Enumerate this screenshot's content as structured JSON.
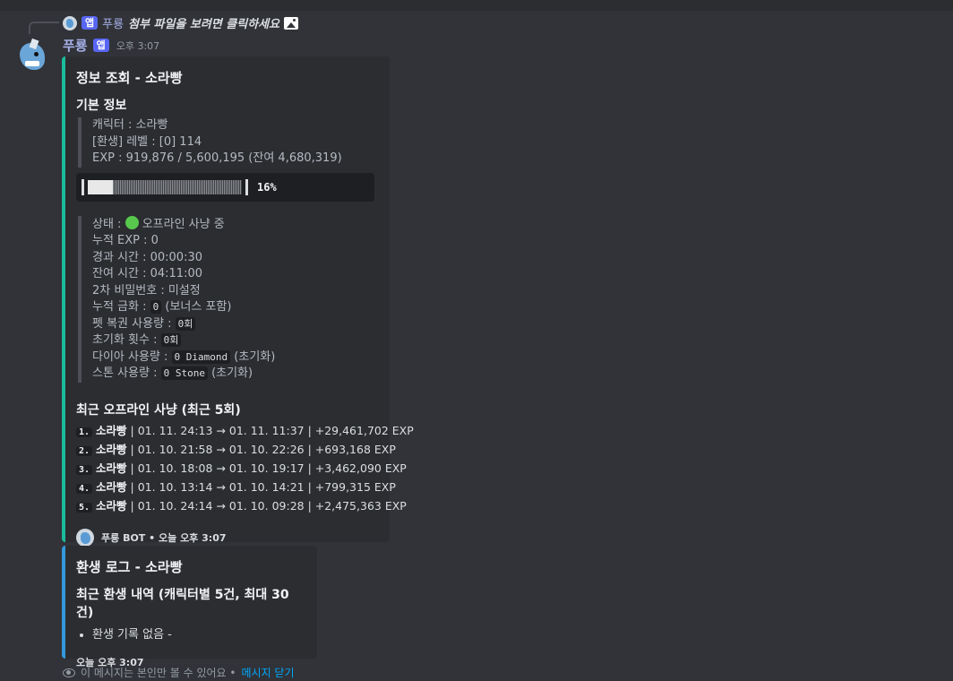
{
  "reply": {
    "app_badge": "앱",
    "name": "푸룡",
    "text": "첨부 파일을 보려면 클릭하세요"
  },
  "message": {
    "username": "푸룡",
    "app_badge": "앱",
    "timestamp": "오후 3:07"
  },
  "embed1": {
    "title": "정보 조회 - 소라빵",
    "basic_info_title": "기본 정보",
    "basic_lines": [
      "캐릭터 : 소라빵",
      "[환생] 레벨 : [0] 114",
      "EXP : 919,876 / 5,600,195 (잔여 4,680,319)"
    ],
    "progress": {
      "fraction": 0.16,
      "label": "16%"
    },
    "status_prefix": "상태 : ",
    "status_text": " 오프라인 사냥 중",
    "plain_lines": [
      "누적 EXP : 0",
      "경과 시간 : 00:00:30",
      "잔여 시간 : 04:11:00",
      "2차 비밀번호 : 미설정"
    ],
    "reinforce": {
      "label": "누적 금화 : ",
      "code": "0",
      "suffix": " (보너스 포함)"
    },
    "pet": {
      "label": "펫 복권 사용량 : ",
      "code": "0회"
    },
    "reset": {
      "label": "초기화 횟수 : ",
      "code": "0회"
    },
    "diamond": {
      "label": "다이아 사용량 : ",
      "code": "0 Diamond",
      "suffix": " (초기화)"
    },
    "stone": {
      "label": "스톤 사용량 : ",
      "code": "0 Stone",
      "suffix": " (초기화)"
    },
    "hunts_title": "최근 오프라인 사냥 (최근 5회)",
    "hunts": [
      {
        "num": "1.",
        "name": "소라빵",
        "text": " | 01. 11. 24:13 → 01. 11. 11:37 | +29,461,702 EXP"
      },
      {
        "num": "2.",
        "name": "소라빵",
        "text": " | 01. 10. 21:58 → 01. 10. 22:26 | +693,168 EXP"
      },
      {
        "num": "3.",
        "name": "소라빵",
        "text": " | 01. 10. 18:08 → 01. 10. 19:17 | +3,462,090 EXP"
      },
      {
        "num": "4.",
        "name": "소라빵",
        "text": " | 01. 10. 13:14 → 01. 10. 14:21 | +799,315 EXP"
      },
      {
        "num": "5.",
        "name": "소라빵",
        "text": " | 01. 10. 24:14 → 01. 10. 09:28 | +2,475,363 EXP"
      }
    ],
    "footer": "푸룡 BOT • 오늘 오후 3:07",
    "accent_color": "#1abc9c"
  },
  "embed2": {
    "title": "환생 로그 - 소라빵",
    "field_title": "최근 환생 내역 (캐릭터별 5건, 최대 30건)",
    "item": "환생 기록 없음 -",
    "footer": "오늘 오후 3:07",
    "accent_color": "#3498db"
  },
  "ephemeral": {
    "text": "이 메시지는 본인만 볼 수 있어요 • ",
    "dismiss": "메시지 닫기"
  },
  "icons": {
    "reply_avatar": "dragon-avatar-icon",
    "image": "image-icon",
    "eye": "eye-icon"
  }
}
